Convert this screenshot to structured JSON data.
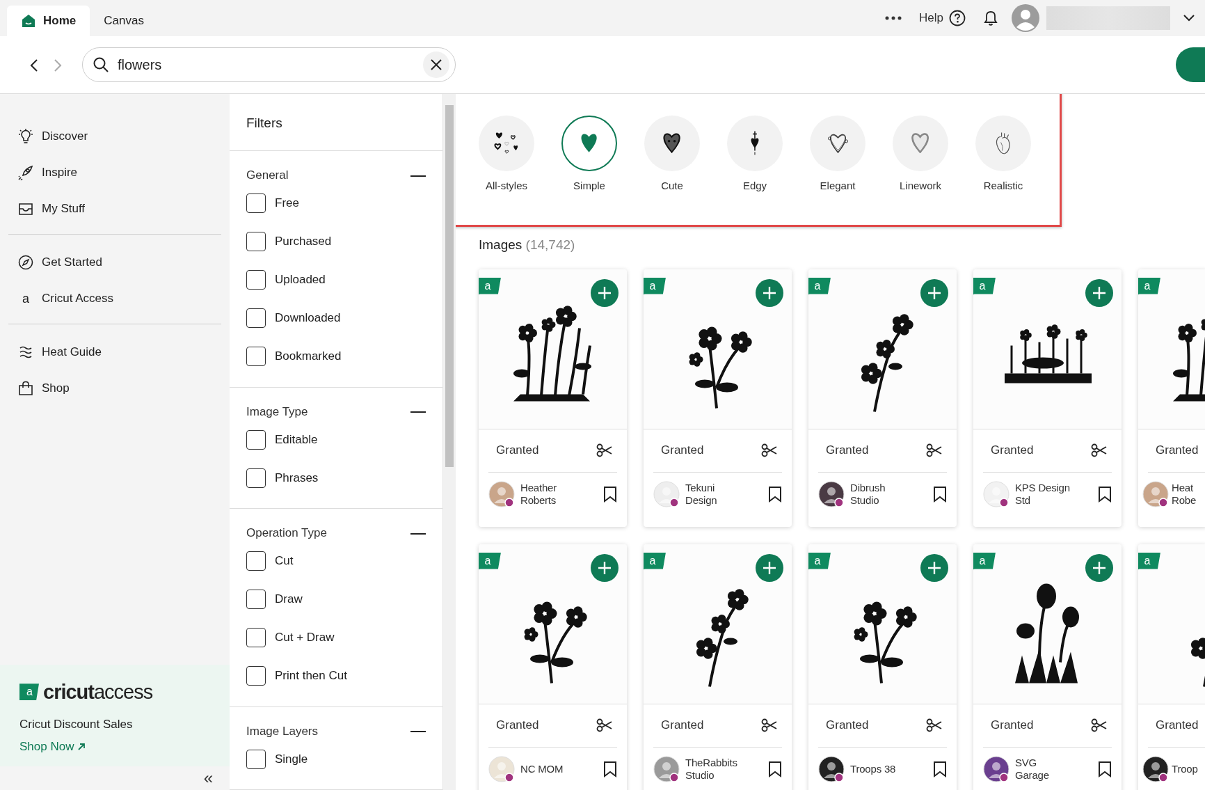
{
  "tabs": [
    {
      "label": "Home",
      "selected": true,
      "kind": "home"
    },
    {
      "label": "Canvas",
      "selected": false,
      "kind": "plain"
    }
  ],
  "header": {
    "help": "Help"
  },
  "search": {
    "value": "flowers"
  },
  "sidebar": {
    "groups": [
      [
        {
          "label": "Discover",
          "kind": "bulb"
        },
        {
          "label": "Inspire",
          "kind": "rocket"
        },
        {
          "label": "My Stuff",
          "kind": "inbox"
        }
      ],
      [
        {
          "label": "Get Started",
          "kind": "compass"
        },
        {
          "label": "Cricut Access",
          "kind": "letter",
          "icon_text": "a"
        }
      ],
      [
        {
          "label": "Heat Guide",
          "kind": "waves"
        },
        {
          "label": "Shop",
          "kind": "bag"
        }
      ]
    ],
    "promo": {
      "badge": "a",
      "brand_bold": "cricut",
      "brand_light": "access",
      "subtitle": "Cricut Discount Sales",
      "link": "Shop Now"
    },
    "collapse": "«"
  },
  "filters": {
    "title": "Filters",
    "sections": [
      {
        "title": "General",
        "expanded": true,
        "options": [
          {
            "label": "Free",
            "checked": false
          },
          {
            "label": "Purchased",
            "checked": false
          },
          {
            "label": "Uploaded",
            "checked": false
          },
          {
            "label": "Downloaded",
            "checked": false
          },
          {
            "label": "Bookmarked",
            "checked": false
          }
        ]
      },
      {
        "title": "Image Type",
        "expanded": true,
        "options": [
          {
            "label": "Editable",
            "checked": false
          },
          {
            "label": "Phrases",
            "checked": false
          }
        ]
      },
      {
        "title": "Operation Type",
        "expanded": true,
        "options": [
          {
            "label": "Cut",
            "checked": false
          },
          {
            "label": "Draw",
            "checked": false
          },
          {
            "label": "Cut + Draw",
            "checked": false
          },
          {
            "label": "Print then Cut",
            "checked": false
          }
        ]
      },
      {
        "title": "Image Layers",
        "expanded": true,
        "options": [
          {
            "label": "Single",
            "checked": false
          }
        ]
      }
    ]
  },
  "styles": [
    {
      "label": "All-styles",
      "kind": "many",
      "selected": false
    },
    {
      "label": "Simple",
      "kind": "solid",
      "selected": true
    },
    {
      "label": "Cute",
      "kind": "cute",
      "selected": false
    },
    {
      "label": "Edgy",
      "kind": "dagger",
      "selected": false
    },
    {
      "label": "Elegant",
      "kind": "ornate",
      "selected": false
    },
    {
      "label": "Linework",
      "kind": "outline",
      "selected": false
    },
    {
      "label": "Realistic",
      "kind": "anatomical",
      "selected": false
    }
  ],
  "images": {
    "title": "Images",
    "count": "(14,742)"
  },
  "cards": [
    {
      "badge": "a",
      "status": "Granted",
      "author": [
        "Heather",
        "Roberts"
      ],
      "color": "#c9a58a"
    },
    {
      "badge": "a",
      "status": "Granted",
      "author": [
        "Tekuni",
        "Design"
      ],
      "color": "#eeeeee"
    },
    {
      "badge": "a",
      "status": "Granted",
      "author": [
        "Dibrush",
        "Studio"
      ],
      "color": "#4a3a44"
    },
    {
      "badge": "a",
      "status": "Granted",
      "author": [
        "KPS Design",
        "Std"
      ],
      "color": "#f2f2f2"
    },
    {
      "badge": "a",
      "status": "Granted",
      "author": [
        "Heat",
        "Robe"
      ],
      "color": "#c9a58a"
    },
    {
      "badge": "a",
      "status": "Granted",
      "author": [
        "NC MOM"
      ],
      "color": "#ece4d6"
    },
    {
      "badge": "a",
      "status": "Granted",
      "author": [
        "TheRabbits",
        "Studio"
      ],
      "color": "#9a9a9a"
    },
    {
      "badge": "a",
      "status": "Granted",
      "author": [
        "Troops 38"
      ],
      "color": "#222222"
    },
    {
      "badge": "a",
      "status": "Granted",
      "author": [
        "SVG",
        "Garage"
      ],
      "color": "#6a3f8f"
    },
    {
      "badge": "a",
      "status": "Granted",
      "author": [
        "Troop"
      ],
      "color": "#222222"
    }
  ]
}
